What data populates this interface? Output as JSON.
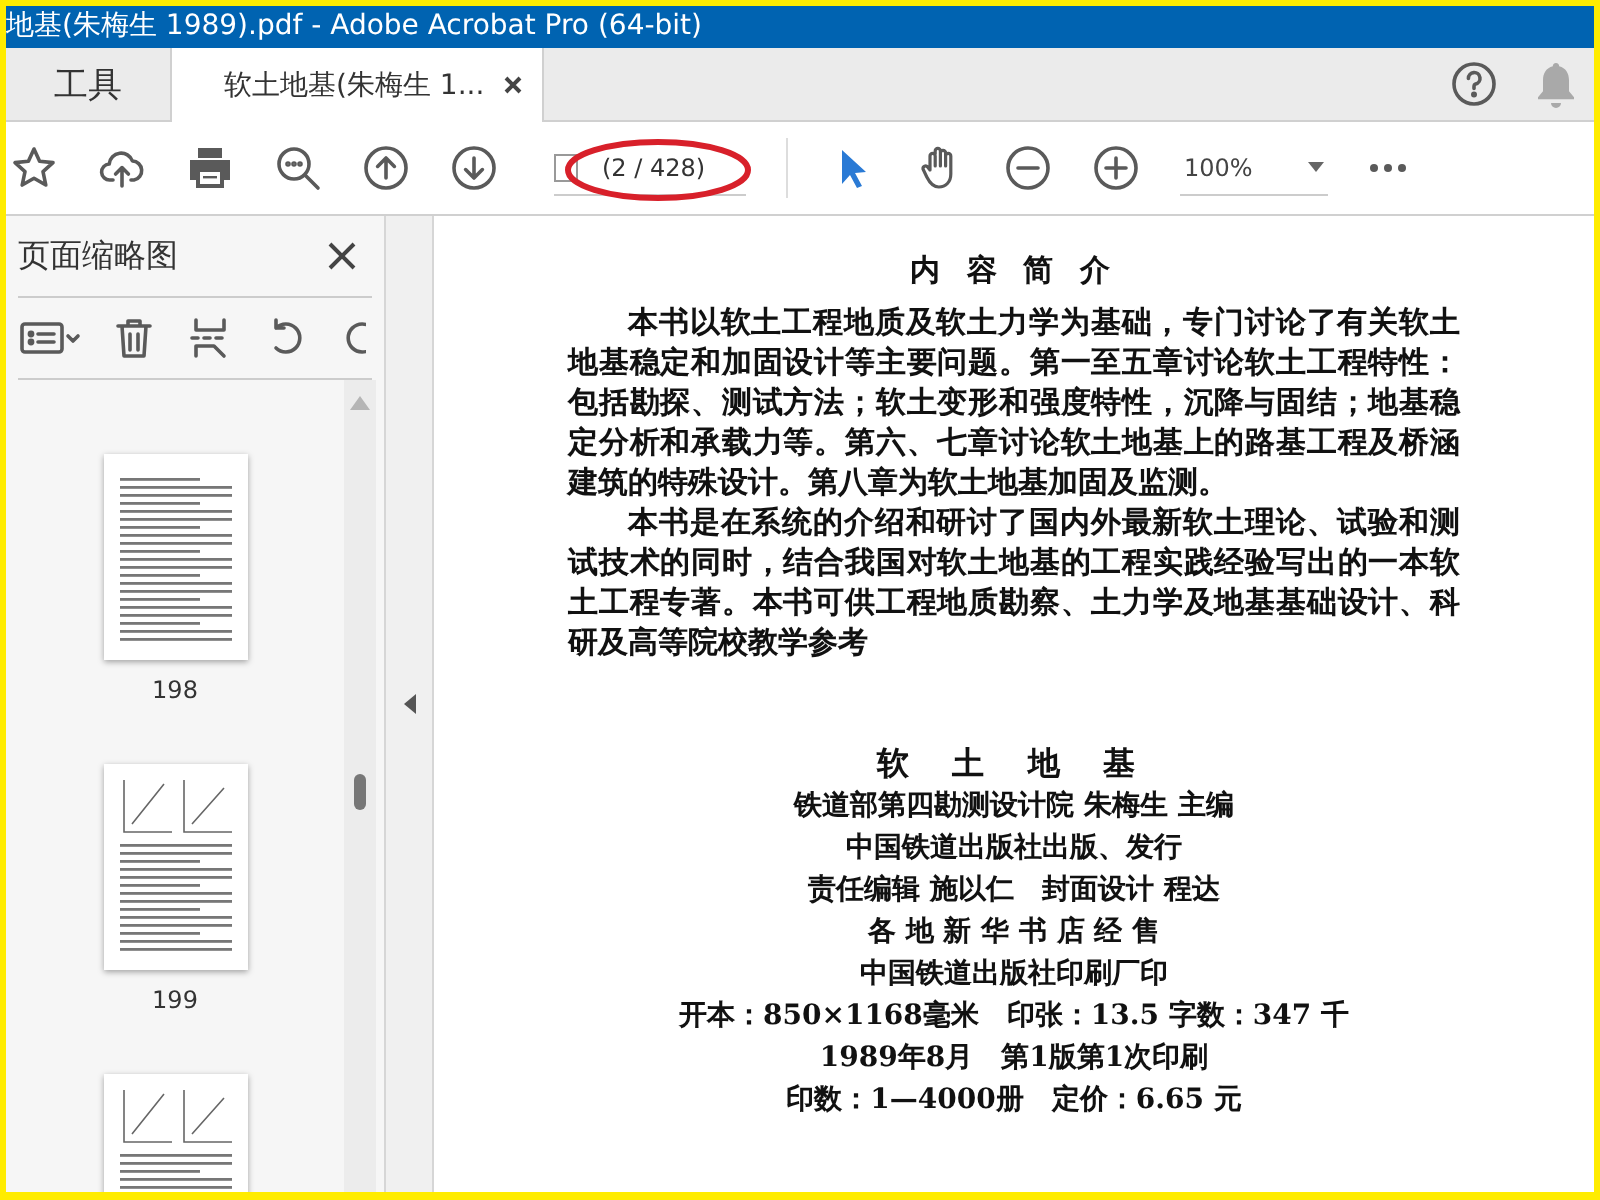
{
  "window": {
    "title": "地基(朱梅生 1989).pdf - Adobe Acrobat Pro (64-bit)"
  },
  "tabs": [
    {
      "label": "工具",
      "selected": false,
      "closable": false
    },
    {
      "label": "软土地基(朱梅生 1...",
      "selected": true,
      "closable": true
    }
  ],
  "toolbar": {
    "page_field": "(2 / 428)",
    "zoom": "100%",
    "tools": [
      {
        "kind": "select",
        "selected": true
      },
      {
        "kind": "hand",
        "selected": false
      }
    ]
  },
  "thumbnail_panel": {
    "title": "页面缩略图",
    "thumbnails": [
      {
        "label": "198",
        "kind": "text"
      },
      {
        "label": "199",
        "kind": "figure"
      },
      {
        "kind": "figure"
      }
    ]
  },
  "document": {
    "heading": "内 容 简 介",
    "paragraphs": [
      "本书以软土工程地质及软土力学为基础，专门讨论了有关软土地基稳定和加固设计等主要问题。第一至五章讨论软土工程特性：包括勘探、测试方法；软土变形和强度特性，沉降与固结；地基稳定分析和承载力等。第六、七章讨论软土地基上的路基工程及桥涵建筑的特殊设计。第八章为软土地基加固及监测。",
      "本书是在系统的介绍和研讨了国内外最新软土理论、试验和测试技术的同时，结合我国对软土地基的工程实践经验写出的一本软土工程专著。本书可供工程地质勘察、土力学及地基基础设计、科研及高等院校教学参考"
    ],
    "colophon_title": "软 土 地 基",
    "colophon_lines": [
      "铁道部第四勘测设计院 朱梅生 主编",
      "中国铁道出版社出版、发行",
      "责任编辑 施以仁　封面设计 程达",
      "各 地 新 华 书 店 经 售",
      "中国铁道出版社印刷厂印",
      "开本：850×1168毫米　印张：13.5 字数：347 千",
      "1989年8月　第1版第1次印刷",
      "印数：1—4000册　定价：6.65 元"
    ]
  }
}
